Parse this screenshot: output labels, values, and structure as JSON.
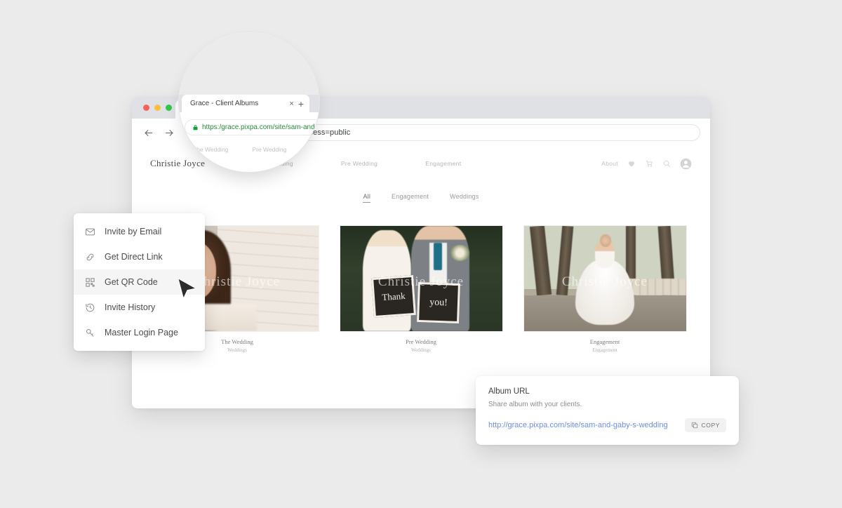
{
  "browser": {
    "tab_title": "Grace - Client Albums",
    "tab_close": "×",
    "new_tab": "+",
    "url_visible": "n-and-gaby-s-wedding?access=public",
    "magnified_url": "https:/grace.pixpa.com/site/sam-and"
  },
  "site": {
    "logo": "Christie Joyce",
    "nav_links": [
      "The Wedding",
      "Pre Wedding",
      "Engagement"
    ],
    "about_label": "About",
    "watermark": "Christie Joyce",
    "filters": [
      {
        "label": "All",
        "active": true
      },
      {
        "label": "Engagement",
        "active": false
      },
      {
        "label": "Weddings",
        "active": false
      }
    ],
    "albums": [
      {
        "title": "The Wedding",
        "category": "Weddings"
      },
      {
        "title": "Pre Wedding",
        "category": "Weddings"
      },
      {
        "title": "Engagement",
        "category": "Engagement"
      }
    ],
    "photo2_board_a": "Thank",
    "photo2_board_b": "you!"
  },
  "share_menu": {
    "items": [
      {
        "label": "Invite by Email",
        "icon": "envelope-icon",
        "hover": false
      },
      {
        "label": "Get Direct Link",
        "icon": "link-icon",
        "hover": false
      },
      {
        "label": "Get QR Code",
        "icon": "qr-code-icon",
        "hover": true
      },
      {
        "label": "Invite History",
        "icon": "clock-history-icon",
        "hover": false
      },
      {
        "label": "Master Login Page",
        "icon": "key-icon",
        "hover": false
      }
    ]
  },
  "album_url_popup": {
    "title": "Album URL",
    "subtitle": "Share album with your clients.",
    "url": "http://grace.pixpa.com/site/sam-and-gaby-s-wedding",
    "copy_label": "COPY"
  },
  "colors": {
    "background": "#ebebeb",
    "titlebar": "#dfe1e5",
    "link": "#6f8ee0",
    "secure_green": "#169a40",
    "traffic_red": "#f7635b",
    "traffic_yellow": "#fbbe40",
    "traffic_green": "#31c748"
  }
}
